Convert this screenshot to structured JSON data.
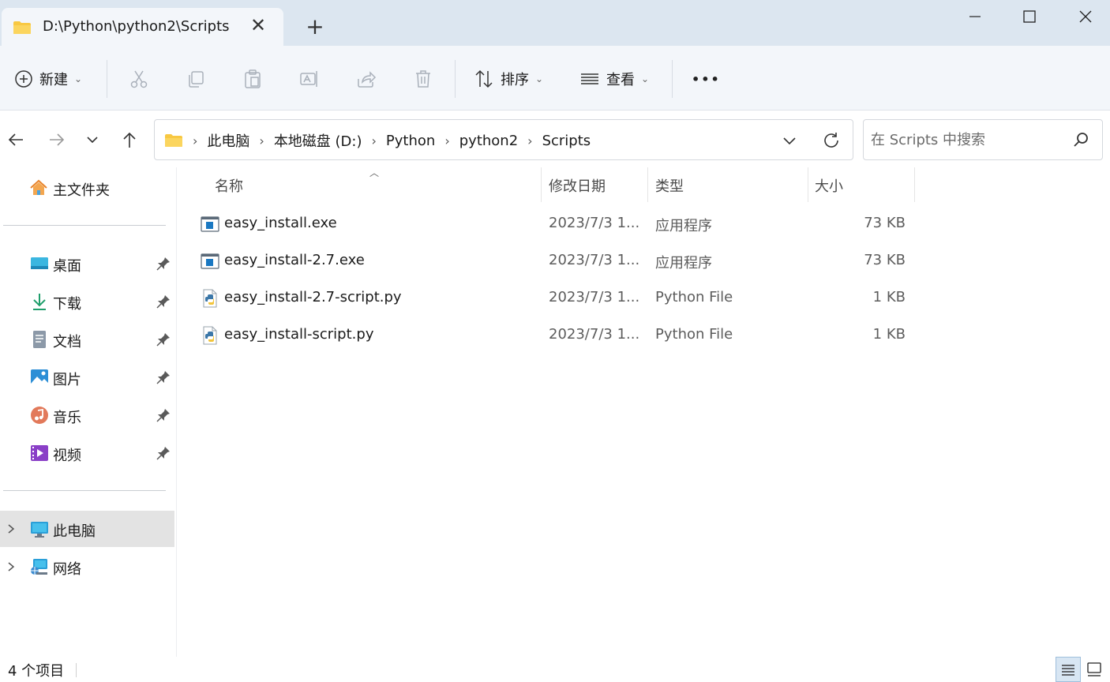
{
  "window": {
    "tab_title": "D:\\Python\\python2\\Scripts",
    "tab_close": "✕",
    "new_tab": "+"
  },
  "toolbar": {
    "new_label": "新建",
    "sort_label": "排序",
    "view_label": "查看",
    "more": "•••"
  },
  "address": {
    "crumbs": [
      "此电脑",
      "本地磁盘 (D:)",
      "Python",
      "python2",
      "Scripts"
    ],
    "separator": "›"
  },
  "search": {
    "placeholder": "在 Scripts 中搜索"
  },
  "sidebar": {
    "home": "主文件夹",
    "quick_access": [
      {
        "label": "桌面",
        "icon": "desktop-icon"
      },
      {
        "label": "下载",
        "icon": "download-icon"
      },
      {
        "label": "文档",
        "icon": "documents-icon"
      },
      {
        "label": "图片",
        "icon": "pictures-icon"
      },
      {
        "label": "音乐",
        "icon": "music-icon"
      },
      {
        "label": "视频",
        "icon": "videos-icon"
      }
    ],
    "this_pc": "此电脑",
    "network": "网络"
  },
  "columns": {
    "name": "名称",
    "date": "修改日期",
    "type": "类型",
    "size": "大小"
  },
  "files": [
    {
      "name": "easy_install.exe",
      "date": "2023/7/3 1...",
      "type": "应用程序",
      "size": "73 KB",
      "icon": "exe-icon"
    },
    {
      "name": "easy_install-2.7.exe",
      "date": "2023/7/3 1...",
      "type": "应用程序",
      "size": "73 KB",
      "icon": "exe-icon"
    },
    {
      "name": "easy_install-2.7-script.py",
      "date": "2023/7/3 1...",
      "type": "Python File",
      "size": "1 KB",
      "icon": "python-file-icon"
    },
    {
      "name": "easy_install-script.py",
      "date": "2023/7/3 1...",
      "type": "Python File",
      "size": "1 KB",
      "icon": "python-file-icon"
    }
  ],
  "status": {
    "item_count": "4 个项目"
  },
  "colors": {
    "titlebar_bg": "#dce6f0",
    "toolbar_bg": "#f3f6fa",
    "folder_yellow": "#f8c842",
    "selected_bg": "#e3e3e3",
    "accent_blue": "#0f6cbd"
  }
}
